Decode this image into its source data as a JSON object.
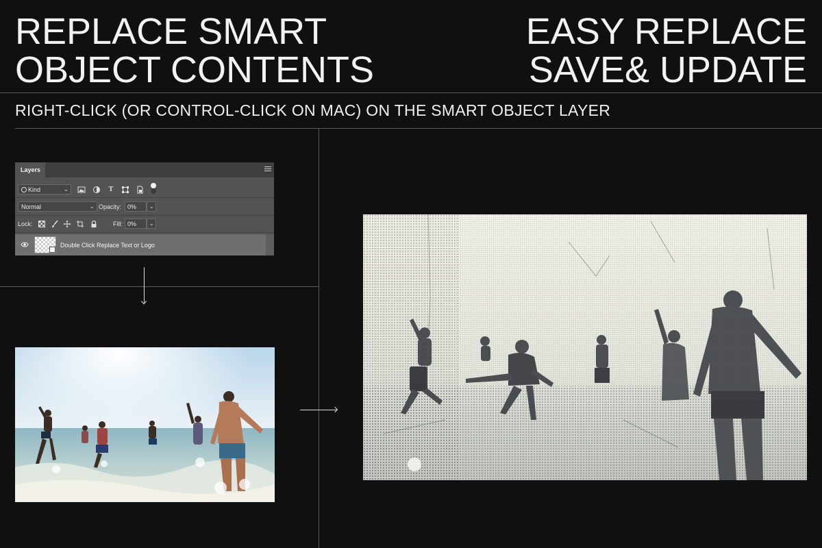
{
  "headline_left": {
    "line1": "REPLACE SMART",
    "line2": "OBJECT CONTENTS"
  },
  "headline_right": {
    "line1": "EASY REPLACE",
    "line2": "SAVE& UPDATE"
  },
  "instruction": "RIGHT-CLICK (OR CONTROL-CLICK ON MAC) ON THE SMART OBJECT LAYER",
  "layers_panel": {
    "tab_label": "Layers",
    "filter": {
      "selected": "Kind"
    },
    "blend_mode": {
      "selected": "Normal"
    },
    "opacity": {
      "label": "Opacity:",
      "value": "0%"
    },
    "lock": {
      "label": "Lock:"
    },
    "fill": {
      "label": "Fill:",
      "value": "0%"
    },
    "layer": {
      "name": "Double Click Replace Text or Logo"
    },
    "filter_icons": [
      "image-icon",
      "adjustment-icon",
      "type-icon",
      "shape-icon",
      "smart-object-icon",
      "toggle-dot-icon"
    ],
    "lock_icons": [
      "lock-transparent-icon",
      "lock-brush-icon",
      "lock-move-icon",
      "lock-artboard-icon",
      "lock-all-icon"
    ]
  },
  "colors": {
    "background": "#101010",
    "panel": "#535353",
    "panel_tabbar": "#3f3f3f",
    "selected_layer": "#6f6f6f",
    "divider": "#5a5a5a",
    "text": "#f2f2f2"
  },
  "images": {
    "original": "beach-friends-running-photo",
    "result": "grunge-halftone-beach-photo"
  }
}
